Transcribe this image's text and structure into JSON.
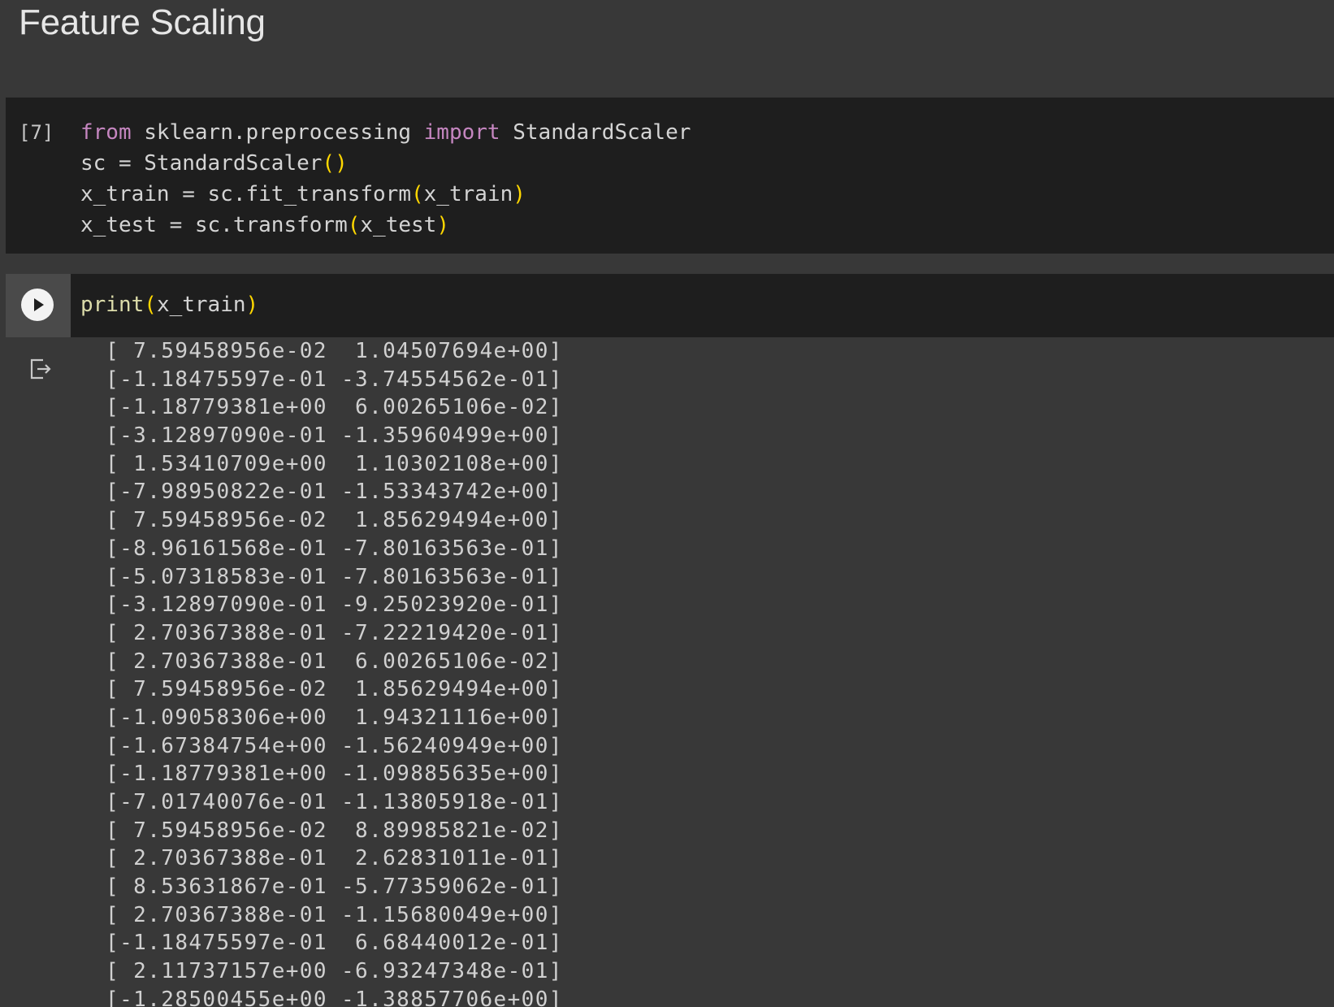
{
  "section": {
    "heading": "Feature Scaling"
  },
  "cell1": {
    "execution_count": "[7]",
    "lines": [
      [
        {
          "t": "from",
          "c": "kw"
        },
        {
          "t": " sklearn.preprocessing ",
          "c": ""
        },
        {
          "t": "import",
          "c": "kw"
        },
        {
          "t": " StandardScaler",
          "c": ""
        }
      ],
      [
        {
          "t": "sc = StandardScaler",
          "c": ""
        },
        {
          "t": "()",
          "c": "paren"
        }
      ],
      [
        {
          "t": "x_train = sc.fit_transform",
          "c": ""
        },
        {
          "t": "(",
          "c": "paren"
        },
        {
          "t": "x_train",
          "c": ""
        },
        {
          "t": ")",
          "c": "paren"
        }
      ],
      [
        {
          "t": "x_test = sc.transform",
          "c": ""
        },
        {
          "t": "(",
          "c": "paren"
        },
        {
          "t": "x_test",
          "c": ""
        },
        {
          "t": ")",
          "c": "paren"
        }
      ]
    ]
  },
  "cell2": {
    "run_icon": "play-icon",
    "lines": [
      [
        {
          "t": "print",
          "c": "fn"
        },
        {
          "t": "(",
          "c": "paren"
        },
        {
          "t": "x_train",
          "c": ""
        },
        {
          "t": ")",
          "c": "paren"
        }
      ]
    ]
  },
  "output": {
    "icon": "output-redirect-icon",
    "lines": [
      " [ 7.59458956e-02  1.04507694e+00]",
      " [-1.18475597e-01 -3.74554562e-01]",
      " [-1.18779381e+00  6.00265106e-02]",
      " [-3.12897090e-01 -1.35960499e+00]",
      " [ 1.53410709e+00  1.10302108e+00]",
      " [-7.98950822e-01 -1.53343742e+00]",
      " [ 7.59458956e-02  1.85629494e+00]",
      " [-8.96161568e-01 -7.80163563e-01]",
      " [-5.07318583e-01 -7.80163563e-01]",
      " [-3.12897090e-01 -9.25023920e-01]",
      " [ 2.70367388e-01 -7.22219420e-01]",
      " [ 2.70367388e-01  6.00265106e-02]",
      " [ 7.59458956e-02  1.85629494e+00]",
      " [-1.09058306e+00  1.94321116e+00]",
      " [-1.67384754e+00 -1.56240949e+00]",
      " [-1.18779381e+00 -1.09885635e+00]",
      " [-7.01740076e-01 -1.13805918e-01]",
      " [ 7.59458956e-02  8.89985821e-02]",
      " [ 2.70367388e-01  2.62831011e-01]",
      " [ 8.53631867e-01 -5.77359062e-01]",
      " [ 2.70367388e-01 -1.15680049e+00]",
      " [-1.18475597e-01  6.68440012e-01]",
      " [ 2.11737157e+00 -6.93247348e-01]",
      " [-1.28500455e+00 -1.38857706e+00]"
    ]
  },
  "colors": {
    "background": "#383838",
    "cell_background": "#1e1e1e",
    "keyword": "#c586c0",
    "function": "#dcdcaa",
    "paren": "#ffd700",
    "text": "#d4d4d4"
  }
}
